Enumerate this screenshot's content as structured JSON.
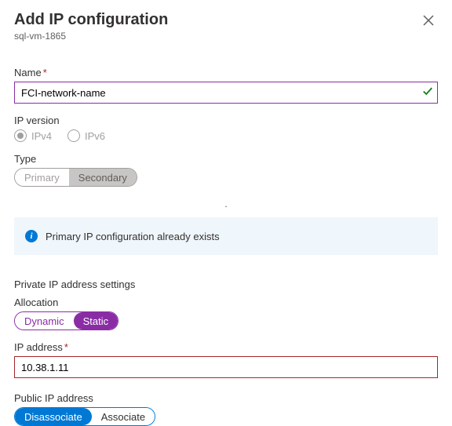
{
  "header": {
    "title": "Add IP configuration",
    "subtitle": "sql-vm-1865"
  },
  "name_field": {
    "label": "Name",
    "value": "FCI-network-name",
    "required_mark": "*"
  },
  "ip_version": {
    "label": "IP version",
    "options": [
      "IPv4",
      "IPv6"
    ],
    "selected": "IPv4"
  },
  "type": {
    "label": "Type",
    "options": [
      "Primary",
      "Secondary"
    ],
    "selected": "Secondary"
  },
  "info_message": "Primary IP configuration already exists",
  "private_section": {
    "heading": "Private IP address settings",
    "allocation": {
      "label": "Allocation",
      "options": [
        "Dynamic",
        "Static"
      ],
      "selected": "Static"
    },
    "ip_address": {
      "label": "IP address",
      "value": "10.38.1.11",
      "required_mark": "*"
    }
  },
  "public_ip": {
    "label": "Public IP address",
    "options": [
      "Disassociate",
      "Associate"
    ],
    "selected": "Disassociate"
  }
}
